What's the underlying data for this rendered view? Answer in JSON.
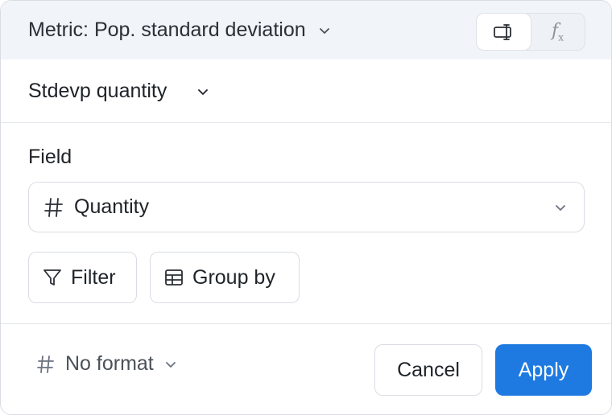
{
  "header": {
    "metric_title": "Metric: Pop. standard deviation",
    "mode_visual_icon": "column-select-icon",
    "mode_formula_icon": "function-icon",
    "formula_label": "f",
    "formula_sub": "x"
  },
  "aggregation": {
    "label": "Stdevp quantity"
  },
  "field": {
    "label": "Field",
    "value": "Quantity",
    "type_icon": "hash-icon"
  },
  "actions": {
    "filter_label": "Filter",
    "group_by_label": "Group by"
  },
  "footer": {
    "format_label": "No format",
    "cancel_label": "Cancel",
    "apply_label": "Apply"
  },
  "colors": {
    "header_bg": "#f1f5f9",
    "accent": "#1e7ae0",
    "border": "#d9dde3"
  }
}
